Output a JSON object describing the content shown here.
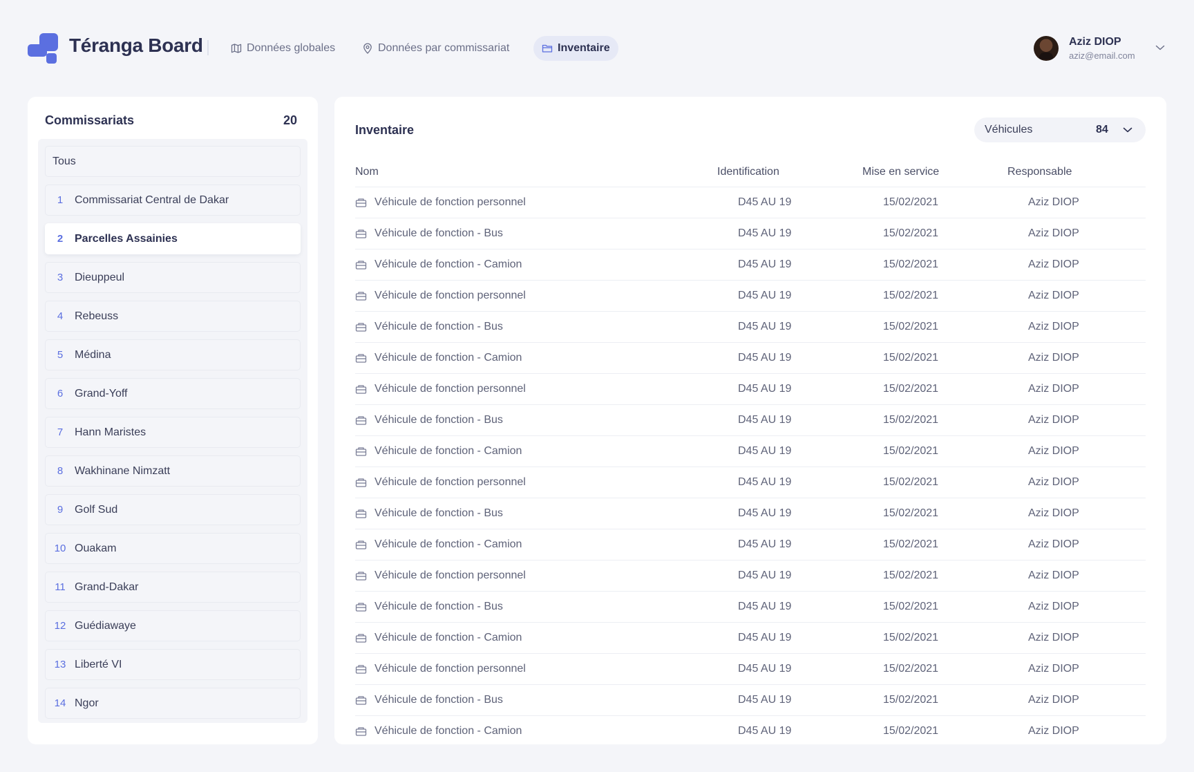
{
  "app": {
    "brand": "Téranga Board",
    "nav": [
      {
        "label": "Données globales",
        "icon": "map-icon",
        "active": false
      },
      {
        "label": "Données par commissariat",
        "icon": "location-pin-icon",
        "active": false
      },
      {
        "label": "Inventaire",
        "icon": "folder-icon",
        "active": true
      }
    ],
    "user": {
      "name": "Aziz DIOP",
      "email": "aziz@email.com"
    }
  },
  "colors": {
    "accent": "#5b6fe0",
    "background": "#f4f5f9",
    "panel": "#ffffff"
  },
  "commissariats": {
    "title": "Commissariats",
    "count": "20",
    "all_label": "Tous",
    "selected_number": "2",
    "items": [
      {
        "number": "1",
        "name": "Commissariat Central de Dakar"
      },
      {
        "number": "2",
        "name": "Parcelles Assainies"
      },
      {
        "number": "3",
        "name": "Dieuppeul"
      },
      {
        "number": "4",
        "name": "Rebeuss"
      },
      {
        "number": "5",
        "name": "Médina"
      },
      {
        "number": "6",
        "name": "Grand-Yoff"
      },
      {
        "number": "7",
        "name": "Hann Maristes"
      },
      {
        "number": "8",
        "name": "Wakhinane Nimzatt"
      },
      {
        "number": "9",
        "name": "Golf Sud"
      },
      {
        "number": "10",
        "name": "Ouakam"
      },
      {
        "number": "11",
        "name": "Grand-Dakar"
      },
      {
        "number": "12",
        "name": "Guédiawaye"
      },
      {
        "number": "13",
        "name": "Liberté VI"
      },
      {
        "number": "14",
        "name": "Ngor"
      }
    ]
  },
  "inventory": {
    "title": "Inventaire",
    "category_select": {
      "label": "Véhicules",
      "count": "84"
    },
    "columns": [
      "Nom",
      "Identification",
      "Mise en service",
      "Responsable"
    ],
    "rows": [
      {
        "name": "Véhicule de fonction personnel",
        "id": "D45 AU 19",
        "date": "15/02/2021",
        "owner": "Aziz DIOP"
      },
      {
        "name": "Véhicule de fonction - Bus",
        "id": "D45 AU 19",
        "date": "15/02/2021",
        "owner": "Aziz DIOP"
      },
      {
        "name": "Véhicule de fonction - Camion",
        "id": "D45 AU 19",
        "date": "15/02/2021",
        "owner": "Aziz DIOP"
      },
      {
        "name": "Véhicule de fonction personnel",
        "id": "D45 AU 19",
        "date": "15/02/2021",
        "owner": "Aziz DIOP"
      },
      {
        "name": "Véhicule de fonction - Bus",
        "id": "D45 AU 19",
        "date": "15/02/2021",
        "owner": "Aziz DIOP"
      },
      {
        "name": "Véhicule de fonction - Camion",
        "id": "D45 AU 19",
        "date": "15/02/2021",
        "owner": "Aziz DIOP"
      },
      {
        "name": "Véhicule de fonction personnel",
        "id": "D45 AU 19",
        "date": "15/02/2021",
        "owner": "Aziz DIOP"
      },
      {
        "name": "Véhicule de fonction - Bus",
        "id": "D45 AU 19",
        "date": "15/02/2021",
        "owner": "Aziz DIOP"
      },
      {
        "name": "Véhicule de fonction - Camion",
        "id": "D45 AU 19",
        "date": "15/02/2021",
        "owner": "Aziz DIOP"
      },
      {
        "name": "Véhicule de fonction personnel",
        "id": "D45 AU 19",
        "date": "15/02/2021",
        "owner": "Aziz DIOP"
      },
      {
        "name": "Véhicule de fonction - Bus",
        "id": "D45 AU 19",
        "date": "15/02/2021",
        "owner": "Aziz DIOP"
      },
      {
        "name": "Véhicule de fonction - Camion",
        "id": "D45 AU 19",
        "date": "15/02/2021",
        "owner": "Aziz DIOP"
      },
      {
        "name": "Véhicule de fonction personnel",
        "id": "D45 AU 19",
        "date": "15/02/2021",
        "owner": "Aziz DIOP"
      },
      {
        "name": "Véhicule de fonction - Bus",
        "id": "D45 AU 19",
        "date": "15/02/2021",
        "owner": "Aziz DIOP"
      },
      {
        "name": "Véhicule de fonction - Camion",
        "id": "D45 AU 19",
        "date": "15/02/2021",
        "owner": "Aziz DIOP"
      },
      {
        "name": "Véhicule de fonction personnel",
        "id": "D45 AU 19",
        "date": "15/02/2021",
        "owner": "Aziz DIOP"
      },
      {
        "name": "Véhicule de fonction - Bus",
        "id": "D45 AU 19",
        "date": "15/02/2021",
        "owner": "Aziz DIOP"
      },
      {
        "name": "Véhicule de fonction - Camion",
        "id": "D45 AU 19",
        "date": "15/02/2021",
        "owner": "Aziz DIOP"
      }
    ]
  }
}
